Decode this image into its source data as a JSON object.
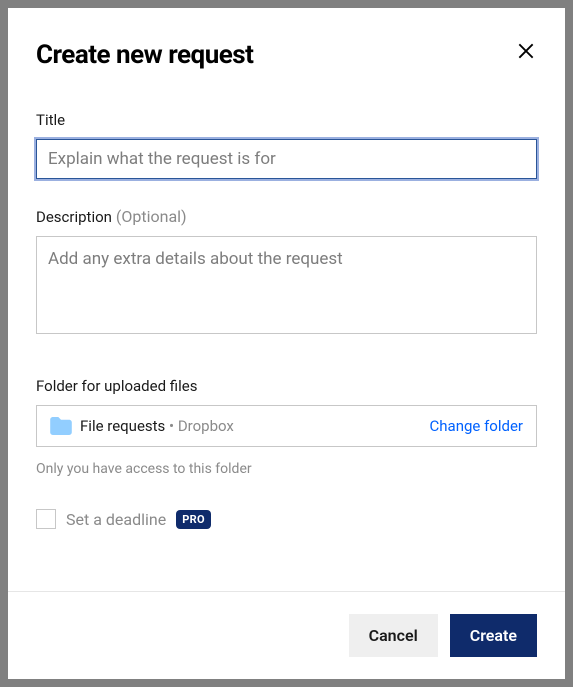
{
  "modal": {
    "title": "Create new request",
    "title_field": {
      "label": "Title",
      "placeholder": "Explain what the request is for",
      "value": ""
    },
    "description_field": {
      "label": "Description",
      "optional_text": "(Optional)",
      "placeholder": "Add any extra details about the request",
      "value": ""
    },
    "folder_field": {
      "label": "Folder for uploaded files",
      "folder_name": "File requests",
      "folder_separator": " • ",
      "folder_path": "Dropbox",
      "change_link": "Change folder",
      "access_note": "Only you have access to this folder"
    },
    "deadline": {
      "label": "Set a deadline",
      "badge": "PRO",
      "checked": false
    },
    "footer": {
      "cancel": "Cancel",
      "create": "Create"
    }
  }
}
